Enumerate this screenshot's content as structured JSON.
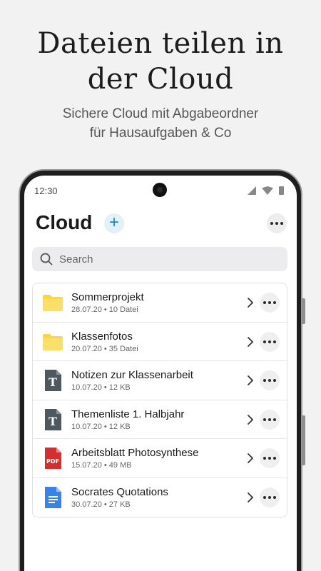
{
  "promo": {
    "title_line1": "Dateien teilen in",
    "title_line2": "der Cloud",
    "subtitle_line1": "Sichere Cloud mit Abgabeordner",
    "subtitle_line2": "für Hausaufgaben & Co"
  },
  "status_bar": {
    "time": "12:30"
  },
  "header": {
    "title": "Cloud",
    "add_label": "+"
  },
  "search": {
    "placeholder": "Search"
  },
  "colors": {
    "accent": "#1a87c8",
    "folder": "#f9d54a",
    "text_doc": "#4e585e",
    "pdf": "#d32f2f",
    "gdoc": "#3b82e8"
  },
  "files": [
    {
      "name": "Sommerprojekt",
      "meta": "28.07.20 • 10 Datei",
      "icon": "folder-icon"
    },
    {
      "name": "Klassenfotos",
      "meta": "20.07.20 • 35 Datei",
      "icon": "folder-icon"
    },
    {
      "name": "Notizen zur Klassenarbeit",
      "meta": "10.07.20 • 12 KB",
      "icon": "text-file-icon",
      "glyph": "T"
    },
    {
      "name": "Themenliste 1. Halbjahr",
      "meta": "10.07.20 • 12 KB",
      "icon": "text-file-icon",
      "glyph": "T"
    },
    {
      "name": "Arbeitsblatt Photosynthese",
      "meta": "15.07.20 • 49 MB",
      "icon": "pdf-file-icon",
      "glyph": "PDF"
    },
    {
      "name": "Socrates Quotations",
      "meta": "30.07.20 • 27 KB",
      "icon": "doc-file-icon"
    }
  ]
}
